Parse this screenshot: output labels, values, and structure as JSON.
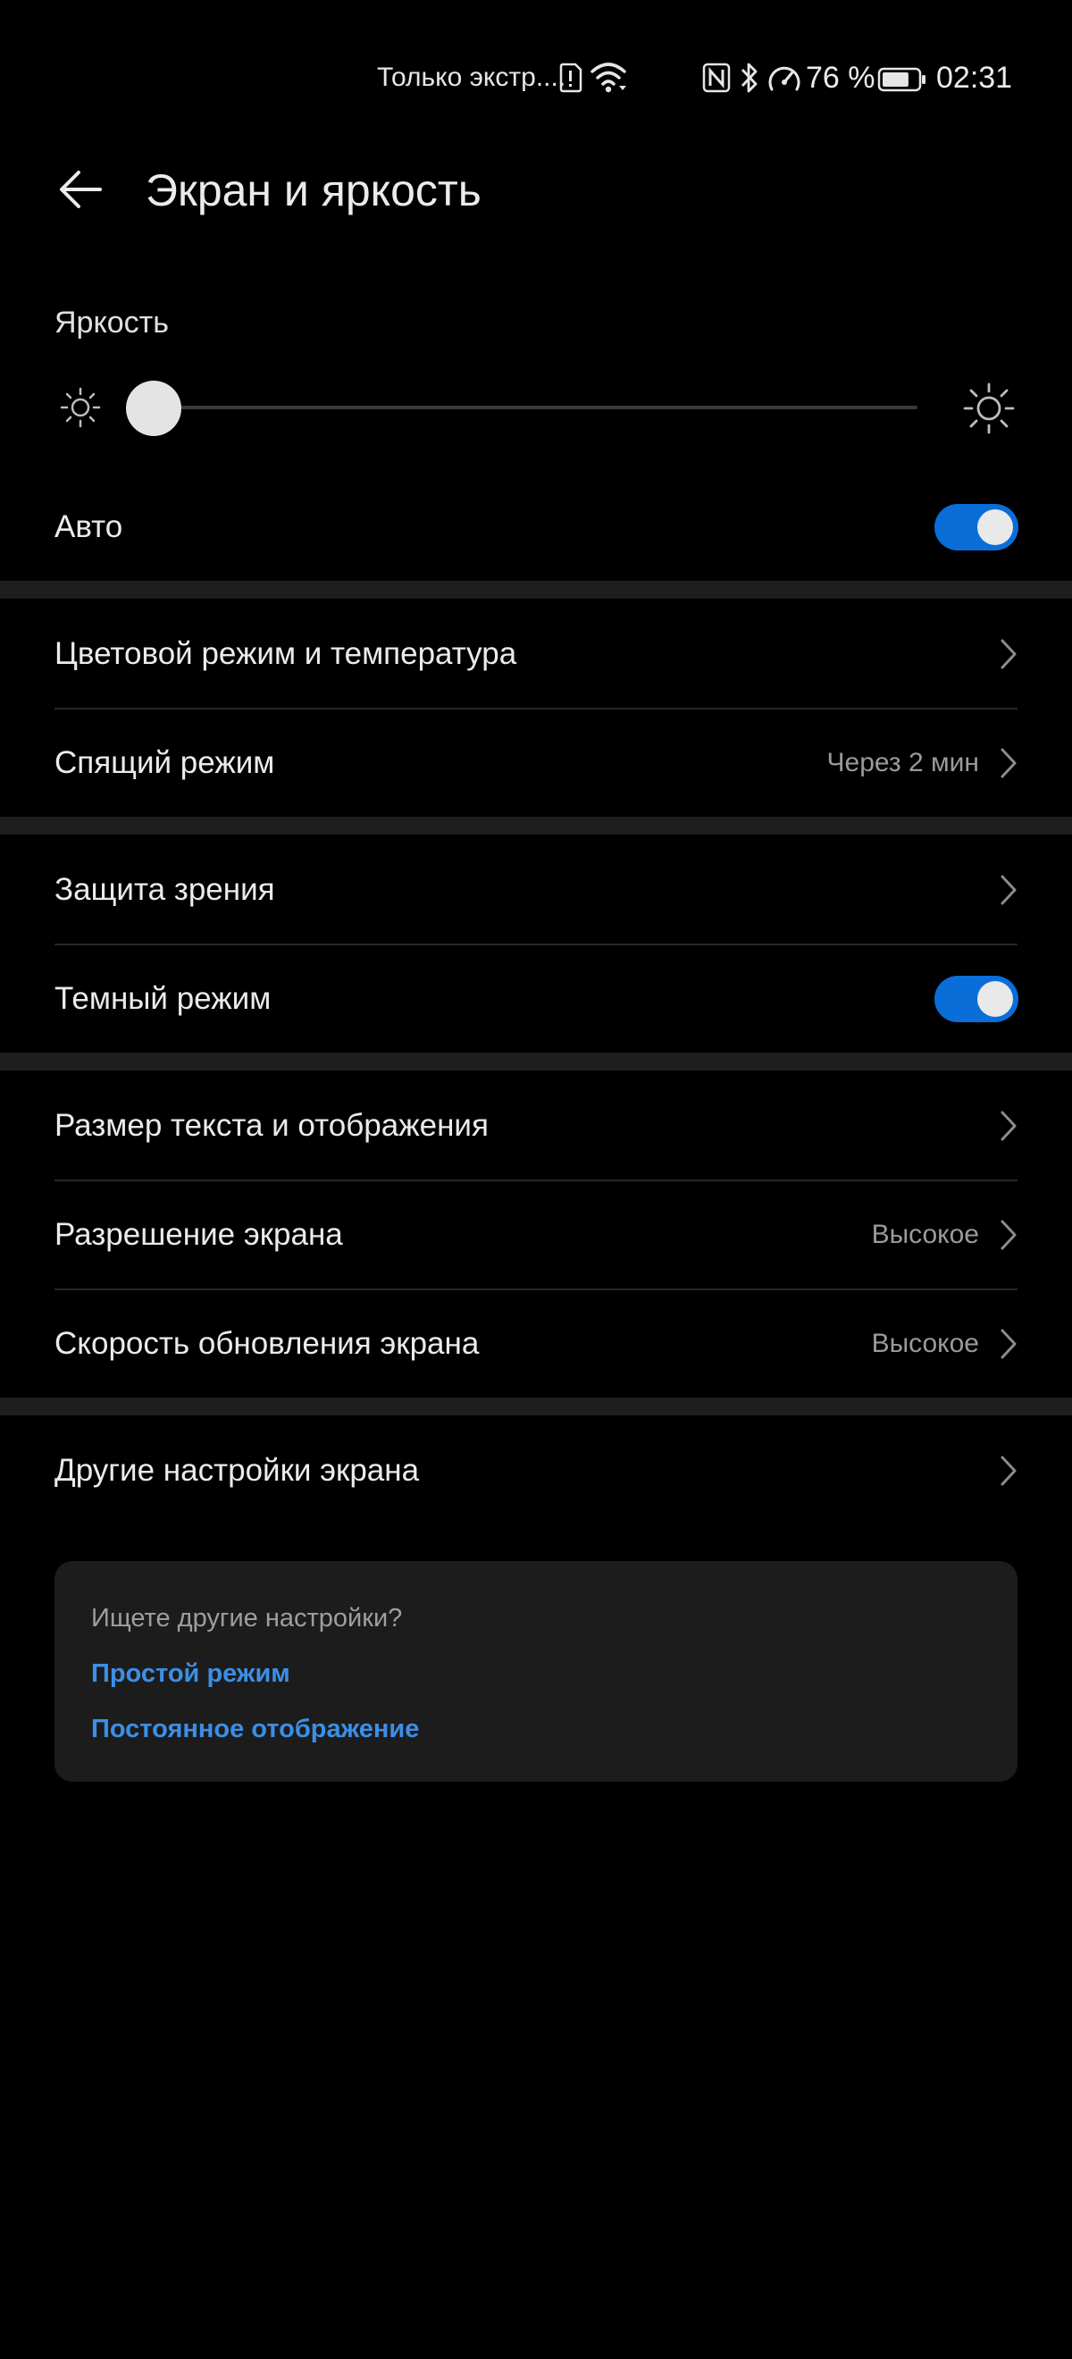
{
  "status_bar": {
    "carrier": "Только экстр....",
    "battery_percent": "76 %",
    "time": "02:31",
    "battery_level": 0.76,
    "icons": [
      "sim-alert-icon",
      "wifi-icon",
      "nfc-icon",
      "bluetooth-icon",
      "speedometer-icon",
      "battery-icon"
    ]
  },
  "header": {
    "title": "Экран и яркость",
    "back_icon": "arrow-left-icon"
  },
  "brightness": {
    "label": "Яркость",
    "level": 0.0,
    "min_icon": "sun-small-icon",
    "max_icon": "sun-large-icon"
  },
  "auto": {
    "label": "Авто",
    "enabled": true
  },
  "groups": [
    {
      "items": [
        {
          "label": "Цветовой режим и температура",
          "value": ""
        },
        {
          "label": "Спящий режим",
          "value": "Через 2 мин"
        }
      ]
    },
    {
      "items": [
        {
          "label": "Защита зрения",
          "value": ""
        },
        {
          "label": "Темный режим",
          "toggle": true,
          "enabled": true
        }
      ]
    },
    {
      "items": [
        {
          "label": "Размер текста и отображения",
          "value": ""
        },
        {
          "label": "Разрешение экрана",
          "value": "Высокое"
        },
        {
          "label": "Скорость обновления экрана",
          "value": "Высокое"
        }
      ]
    },
    {
      "items": [
        {
          "label": "Другие настройки экрана",
          "value": ""
        }
      ]
    }
  ],
  "suggestions": {
    "title": "Ищете другие настройки?",
    "links": [
      "Простой режим",
      "Постоянное отображение"
    ]
  },
  "colors": {
    "background": "#000000",
    "accent": "#0a6ed8",
    "link": "#3b8fe6",
    "card": "#1c1c1c",
    "separator": "#1e1e1e"
  }
}
